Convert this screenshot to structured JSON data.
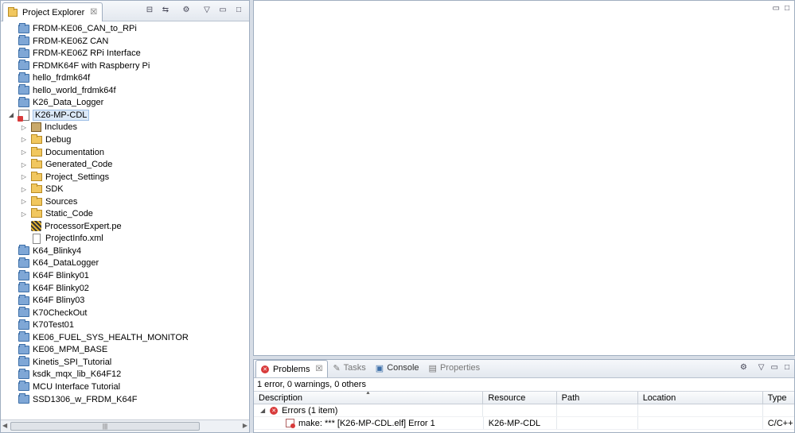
{
  "explorer": {
    "title": "Project Explorer",
    "icons": [
      "collapse-all-icon",
      "link-editor-icon",
      "filter-icon",
      "view-menu-icon",
      "minimize-icon",
      "maximize-icon"
    ],
    "items": [
      {
        "label": "FRDM-KE06_CAN_to_RPi",
        "level": 0,
        "kind": "project",
        "twisty": ""
      },
      {
        "label": "FRDM-KE06Z CAN",
        "level": 0,
        "kind": "project",
        "twisty": ""
      },
      {
        "label": "FRDM-KE06Z RPi Interface",
        "level": 0,
        "kind": "project",
        "twisty": ""
      },
      {
        "label": "FRDMK64F with Raspberry Pi",
        "level": 0,
        "kind": "project",
        "twisty": ""
      },
      {
        "label": "hello_frdmk64f",
        "level": 0,
        "kind": "project",
        "twisty": ""
      },
      {
        "label": "hello_world_frdmk64f",
        "level": 0,
        "kind": "project",
        "twisty": ""
      },
      {
        "label": "K26_Data_Logger",
        "level": 0,
        "kind": "project",
        "twisty": ""
      },
      {
        "label": "K26-MP-CDL",
        "level": 0,
        "kind": "cproject",
        "twisty": "expanded",
        "selected": true
      },
      {
        "label": "Includes",
        "level": 1,
        "kind": "includes",
        "twisty": "collapsed"
      },
      {
        "label": "Debug",
        "level": 1,
        "kind": "folder",
        "twisty": "collapsed"
      },
      {
        "label": "Documentation",
        "level": 1,
        "kind": "folder",
        "twisty": "collapsed"
      },
      {
        "label": "Generated_Code",
        "level": 1,
        "kind": "folder",
        "twisty": "collapsed"
      },
      {
        "label": "Project_Settings",
        "level": 1,
        "kind": "folder",
        "twisty": "collapsed"
      },
      {
        "label": "SDK",
        "level": 1,
        "kind": "folder",
        "twisty": "collapsed"
      },
      {
        "label": "Sources",
        "level": 1,
        "kind": "folder",
        "twisty": "collapsed"
      },
      {
        "label": "Static_Code",
        "level": 1,
        "kind": "folder",
        "twisty": "collapsed"
      },
      {
        "label": "ProcessorExpert.pe",
        "level": 1,
        "kind": "pe",
        "twisty": ""
      },
      {
        "label": "ProjectInfo.xml",
        "level": 1,
        "kind": "file",
        "twisty": ""
      },
      {
        "label": "K64_Blinky4",
        "level": 0,
        "kind": "project",
        "twisty": ""
      },
      {
        "label": "K64_DataLogger",
        "level": 0,
        "kind": "project",
        "twisty": ""
      },
      {
        "label": "K64F Blinky01",
        "level": 0,
        "kind": "project",
        "twisty": ""
      },
      {
        "label": "K64F Blinky02",
        "level": 0,
        "kind": "project",
        "twisty": ""
      },
      {
        "label": "K64F Bliny03",
        "level": 0,
        "kind": "project",
        "twisty": ""
      },
      {
        "label": "K70CheckOut",
        "level": 0,
        "kind": "project",
        "twisty": ""
      },
      {
        "label": "K70Test01",
        "level": 0,
        "kind": "project",
        "twisty": ""
      },
      {
        "label": "KE06_FUEL_SYS_HEALTH_MONITOR",
        "level": 0,
        "kind": "project",
        "twisty": ""
      },
      {
        "label": "KE06_MPM_BASE",
        "level": 0,
        "kind": "project",
        "twisty": ""
      },
      {
        "label": "Kinetis_SPI_Tutorial",
        "level": 0,
        "kind": "project",
        "twisty": ""
      },
      {
        "label": "ksdk_mqx_lib_K64F12",
        "level": 0,
        "kind": "project",
        "twisty": ""
      },
      {
        "label": "MCU Interface Tutorial",
        "level": 0,
        "kind": "project",
        "twisty": ""
      },
      {
        "label": "SSD1306_w_FRDM_K64F",
        "level": 0,
        "kind": "project",
        "twisty": ""
      }
    ]
  },
  "problems": {
    "tabs": [
      {
        "label": "Problems",
        "active": true
      },
      {
        "label": "Tasks",
        "active": false
      },
      {
        "label": "Console",
        "active": false
      },
      {
        "label": "Properties",
        "active": false
      }
    ],
    "summary": "1 error, 0 warnings, 0 others",
    "columns": [
      "Description",
      "Resource",
      "Path",
      "Location",
      "Type"
    ],
    "group_label": "Errors (1 item)",
    "rows": [
      {
        "description": "make: *** [K26-MP-CDL.elf] Error 1",
        "resource": "K26-MP-CDL",
        "path": "",
        "location": "",
        "type": "C/C++ Problem"
      }
    ]
  }
}
